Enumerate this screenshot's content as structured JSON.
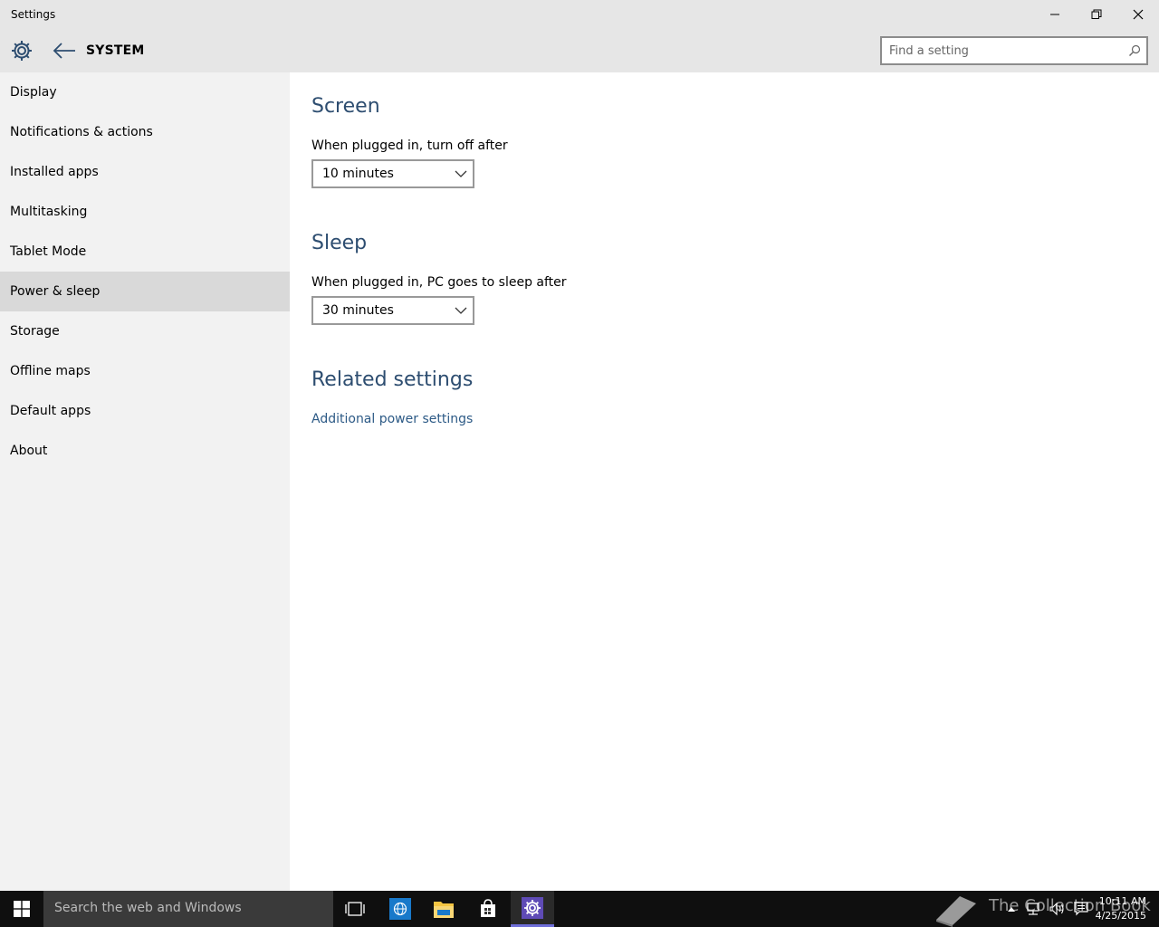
{
  "window": {
    "title": "Settings"
  },
  "header": {
    "section": "SYSTEM",
    "search_placeholder": "Find a setting"
  },
  "sidebar": {
    "items": [
      {
        "label": "Display"
      },
      {
        "label": "Notifications & actions"
      },
      {
        "label": "Installed apps"
      },
      {
        "label": "Multitasking"
      },
      {
        "label": "Tablet Mode"
      },
      {
        "label": "Power & sleep",
        "selected": true
      },
      {
        "label": "Storage"
      },
      {
        "label": "Offline maps"
      },
      {
        "label": "Default apps"
      },
      {
        "label": "About"
      }
    ]
  },
  "content": {
    "screen": {
      "heading": "Screen",
      "label": "When plugged in, turn off after",
      "value": "10 minutes"
    },
    "sleep": {
      "heading": "Sleep",
      "label": "When plugged in, PC goes to sleep after",
      "value": "30 minutes"
    },
    "related": {
      "heading": "Related settings",
      "link": "Additional power settings"
    }
  },
  "taskbar": {
    "search_placeholder": "Search the web and Windows",
    "watermark": "The Collection Book",
    "time": "10:11 AM",
    "date": "4/25/2015"
  },
  "colors": {
    "heading": "#2d4d70",
    "link": "#2d5a86",
    "taskbar": "#0f0f0f",
    "active_app": "#6e6ed8"
  }
}
